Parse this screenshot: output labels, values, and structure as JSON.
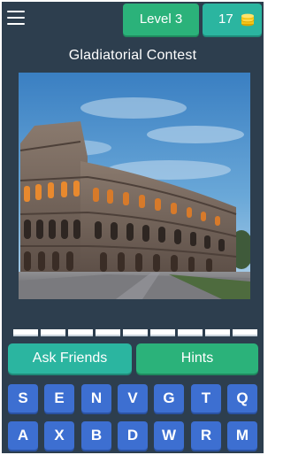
{
  "header": {
    "menu_icon": "hamburger-menu-icon",
    "level_label": "Level 3",
    "coins": "17",
    "coin_icon": "coin-stack-icon"
  },
  "puzzle": {
    "title": "Gladiatorial Contest",
    "answer_slot_count": 9
  },
  "actions": {
    "ask_friends_label": "Ask Friends",
    "hints_label": "Hints"
  },
  "keyboard": {
    "row1": [
      "S",
      "E",
      "N",
      "V",
      "G",
      "T",
      "Q"
    ],
    "row2": [
      "A",
      "X",
      "B",
      "D",
      "W",
      "R",
      "M"
    ]
  },
  "colors": {
    "background": "#2d3e4e",
    "level_green": "#2bb27a",
    "teal": "#2bb5a0",
    "key_blue": "#3d6fd1",
    "coin_gold": "#f5c518"
  }
}
